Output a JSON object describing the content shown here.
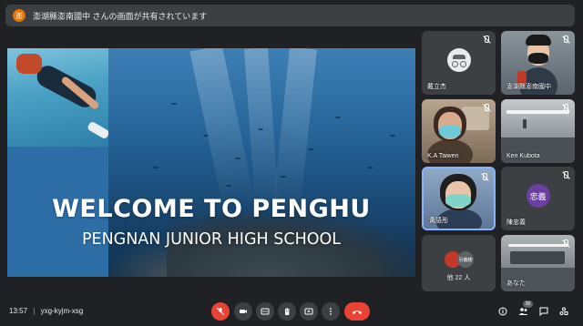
{
  "banner": {
    "avatar_letter": "澎",
    "text": "澎湖縣澎南國中 さんの画面が共有されています"
  },
  "presentation": {
    "title": "WELCOME TO PENGHU",
    "subtitle": "PENGNAN JUNIOR HIGH SCHOOL"
  },
  "tiles": {
    "t1": {
      "name": "戴立杰"
    },
    "t2": {
      "name": "澎湖縣澎南國中"
    },
    "t3": {
      "name": "K.A Taiwen"
    },
    "t4": {
      "name": "Ken Kubota"
    },
    "t5": {
      "name": "黃語彤"
    },
    "t6": {
      "name": "陳忠義",
      "avatar_text": "忠義"
    },
    "t7": {
      "name": "他 22 人",
      "avatar_text": "引義榜"
    },
    "t8": {
      "name": "あなた"
    }
  },
  "bottom": {
    "time": "13:57",
    "separator": "|",
    "meeting_code": "yxg-kyjm-xsg",
    "participant_count": "30"
  },
  "icons": {
    "mic": "mic-off-icon",
    "camera": "videocam-icon",
    "captions": "closed-caption-icon",
    "hand": "raise-hand-icon",
    "present": "present-screen-icon",
    "more": "more-vert-icon",
    "leave": "call-end-icon",
    "info": "info-icon",
    "people": "people-icon",
    "chat": "chat-icon",
    "activities": "activities-icon"
  },
  "colors": {
    "background": "#202124",
    "tile": "#3c4043",
    "danger": "#ea4335",
    "avatar_purple": "#6b3fa0"
  }
}
